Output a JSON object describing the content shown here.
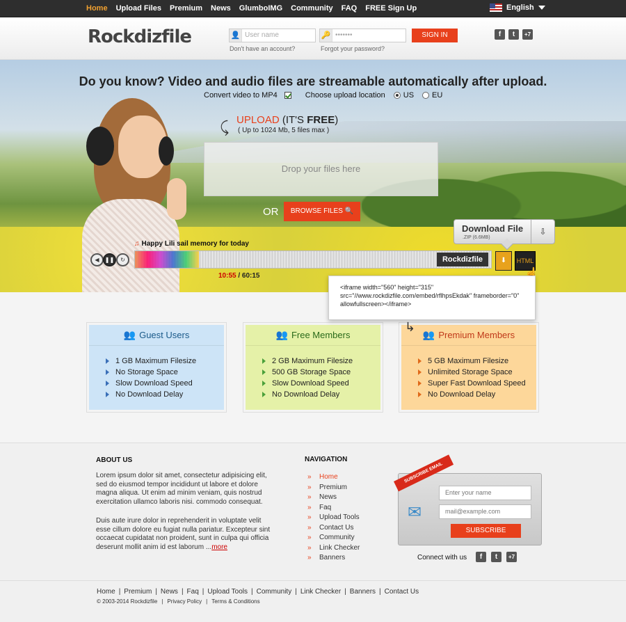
{
  "topnav": {
    "items": [
      "Home",
      "Upload Files",
      "Premium",
      "News",
      "GlumboIMG",
      "Community",
      "FAQ",
      "FREE Sign Up"
    ],
    "active": "Home",
    "language": "English"
  },
  "header": {
    "logo": "Rockdizfile",
    "username_placeholder": "User name",
    "password_placeholder": "•••••••",
    "signin": "SIGN IN",
    "no_account": "Don't have an account?",
    "forgot": "Forgot your password?",
    "social": [
      "f",
      "t",
      "+7"
    ]
  },
  "hero": {
    "title": "Do you know? Video and audio files are streamable automatically after upload.",
    "convert_label": "Convert video to MP4",
    "location_label": "Choose upload location",
    "location_options": [
      "US",
      "EU"
    ],
    "location_selected": "US",
    "upload_word": "UPLOAD",
    "upload_paren_open": "(IT'S ",
    "upload_free": "FREE",
    "upload_paren_close": ")",
    "upload_limit": "( Up to 1024 Mb, 5 files max )",
    "dropzone": "Drop your files here",
    "or": "OR",
    "browse": "BROWSE FILES",
    "player": {
      "song": "Happy Lili sail  memory for today",
      "current": "10:55",
      "total": "/ 60:15",
      "wave_logo": "Rockdizfile",
      "html_btn": "HTML",
      "progress": 0.18
    },
    "download": {
      "title": "Download File",
      "size": ".ZIP (6.6MB)"
    },
    "embed_code": "<iframe width=\"560\" height=\"315\" src=\"//www.rockdizfile.com/embed/rflhpsEkdak\" frameborder=\"0\" allowfullscreen></iframe>"
  },
  "plans": [
    {
      "title": "Guest Users",
      "features": [
        "1 GB Maximum Filesize",
        "No Storage Space",
        "Slow Download Speed",
        "No Download Delay"
      ]
    },
    {
      "title": "Free Members",
      "features": [
        "2 GB Maximum Filesize",
        "500 GB Storage Space",
        "Slow Download Speed",
        "No Download Delay"
      ]
    },
    {
      "title": "Premium Members",
      "features": [
        "5 GB Maximum Filesize",
        "Unlimited Storage Space",
        "Super Fast Download Speed",
        "No Download Delay"
      ]
    }
  ],
  "footer": {
    "about_title": "ABOUT US",
    "about_p1": "Lorem ipsum dolor sit amet, consectetur adipisicing elit, sed do eiusmod tempor incididunt ut labore et dolore magna aliqua. Ut enim ad minim veniam, quis nostrud exercitation ullamco laboris nisi. commodo consequat.",
    "about_p2": "Duis aute irure dolor in reprehenderit in voluptate velit esse cillum dolore eu fugiat nulla pariatur. Excepteur sint occaecat cupidatat non proident, sunt in culpa qui officia deserunt mollit anim id est laborum ...",
    "more": "more",
    "nav_title": "NAVIGATION",
    "nav_items": [
      "Home",
      "Premium",
      "News",
      "Faq",
      "Upload Tools",
      "Contact Us",
      "Community",
      "Link Checker",
      "Banners"
    ],
    "subscribe_ribbon": "SUBSCRIBE EMAIL",
    "name_placeholder": "Enter your name",
    "email_placeholder": "mail@example.com",
    "subscribe": "SUBSCRIBE",
    "connect": "Connect with us",
    "social": [
      "f",
      "t",
      "+7"
    ]
  },
  "bottom": {
    "links": [
      "Home",
      "Premium",
      "News",
      "Faq",
      "Upload Tools",
      "Community",
      "Link Checker",
      "Banners",
      "Contact Us"
    ],
    "copyright": "© 2003-2014 Rockdizfile",
    "privacy": "Privacy Policy",
    "terms": "Terms & Conditions"
  }
}
